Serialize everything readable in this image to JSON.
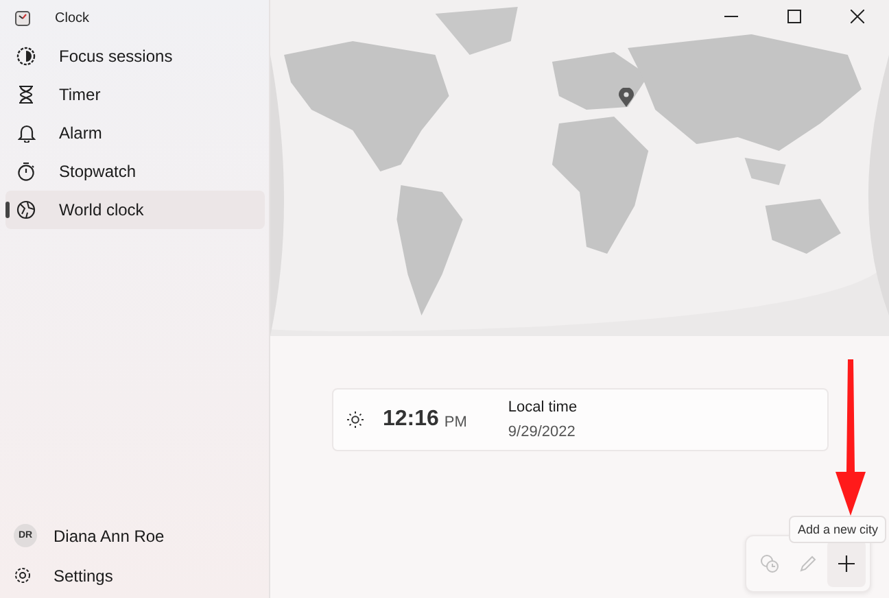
{
  "window": {
    "title": "Clock"
  },
  "nav": {
    "items": [
      {
        "label": "Focus sessions",
        "selected": false
      },
      {
        "label": "Timer",
        "selected": false
      },
      {
        "label": "Alarm",
        "selected": false
      },
      {
        "label": "Stopwatch",
        "selected": false
      },
      {
        "label": "World clock",
        "selected": true
      }
    ],
    "account": {
      "initials": "DR",
      "name": "Diana Ann Roe"
    },
    "settings": "Settings"
  },
  "world_clock": {
    "cities": [
      {
        "time": "12:16",
        "period": "PM",
        "name": "Local time",
        "date": "9/29/2022"
      }
    ],
    "toolbar": [
      {
        "kind": "compare",
        "disabled": true
      },
      {
        "kind": "edit",
        "disabled": true
      },
      {
        "kind": "add",
        "disabled": false
      }
    ],
    "tooltip": "Add a new city"
  },
  "annotation": {
    "kind": "arrow"
  }
}
